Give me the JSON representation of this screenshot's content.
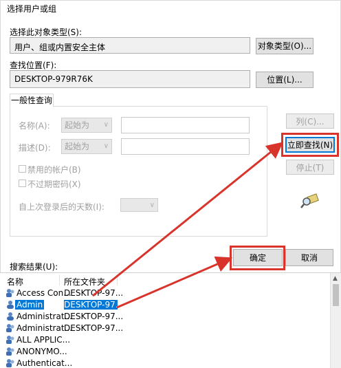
{
  "window": {
    "title": "选择用户或组"
  },
  "object_type": {
    "label": "选择此对象类型(S):",
    "value": "用户、组或内置安全主体",
    "button": "对象类型(O)..."
  },
  "location": {
    "label": "查找位置(F):",
    "value": "DESKTOP-979R76K",
    "button": "位置(L)..."
  },
  "query": {
    "tab": "一般性查询",
    "name_label": "名称(A):",
    "name_mode": "起始为",
    "desc_label": "描述(D):",
    "desc_mode": "起始为",
    "disabled_accounts": "禁用的帐户(B)",
    "no_expire_pwd": "不过期密码(X)",
    "days_since_login": "自上次登录后的天数(I):"
  },
  "side_buttons": {
    "columns": "列(C)...",
    "find_now": "立即查找(N)",
    "stop": "停止(T)"
  },
  "ok_button": "确定",
  "cancel_button": "取消",
  "results": {
    "label": "搜索结果(U):",
    "col_name": "名称",
    "col_folder": "所在文件夹",
    "rows": [
      {
        "name": "Access Con...",
        "folder": "DESKTOP-97..."
      },
      {
        "name": "Admin",
        "folder": "DESKTOP-97..."
      },
      {
        "name": "Administrat...",
        "folder": "DESKTOP-97..."
      },
      {
        "name": "Administrat...",
        "folder": "DESKTOP-97..."
      },
      {
        "name": "ALL APPLIC...",
        "folder": ""
      },
      {
        "name": "ANONYMO...",
        "folder": ""
      },
      {
        "name": "Authenticat...",
        "folder": ""
      }
    ]
  },
  "colors": {
    "highlight": "#d9342b",
    "selection": "#0078d7"
  }
}
